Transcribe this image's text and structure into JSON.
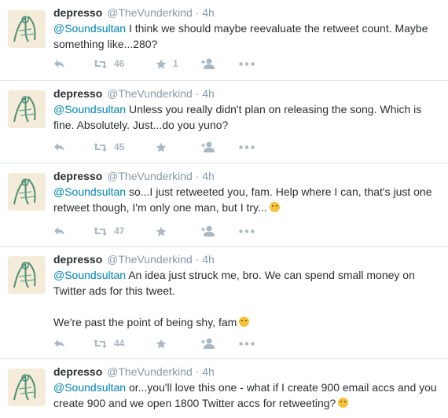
{
  "tweets": [
    {
      "name": "depresso",
      "handle": "@TheVunderkind",
      "dot": "·",
      "time": "4h",
      "mention": "@Soundsultan",
      "paragraphs": [
        "I think we should maybe reevaluate the retweet count. Maybe something like...280?"
      ],
      "retweets": "46",
      "favorites": "1",
      "emoji": ""
    },
    {
      "name": "depresso",
      "handle": "@TheVunderkind",
      "dot": "·",
      "time": "4h",
      "mention": "@Soundsultan",
      "paragraphs": [
        "Unless you really didn't plan on releasing the song. Which is fine. Absolutely. Just...do you yuno?"
      ],
      "retweets": "45",
      "favorites": "",
      "emoji": ""
    },
    {
      "name": "depresso",
      "handle": "@TheVunderkind",
      "dot": "·",
      "time": "4h",
      "mention": "@Soundsultan",
      "paragraphs": [
        "so...I just retweeted you, fam. Help where I can, that's just one retweet though, I'm only one man, but I try..."
      ],
      "retweets": "47",
      "favorites": "",
      "emoji": "relieved-face-emoji"
    },
    {
      "name": "depresso",
      "handle": "@TheVunderkind",
      "dot": "·",
      "time": "4h",
      "mention": "@Soundsultan",
      "paragraphs": [
        "An idea just struck me, bro. We can spend small money on Twitter ads for this tweet.",
        "We're past the point of being shy, fam"
      ],
      "retweets": "44",
      "favorites": "",
      "emoji": "disappointed-relieved-emoji"
    },
    {
      "name": "depresso",
      "handle": "@TheVunderkind",
      "dot": "·",
      "time": "4h",
      "mention": "@Soundsultan",
      "paragraphs": [
        "or...you'll love this one - what if I create 900 email accs and you create 900 and we open 1800 Twitter accs for retweeting?"
      ],
      "retweets": "",
      "favorites": "",
      "emoji": "relieved-face-emoji"
    }
  ],
  "colors": {
    "text": "#292f33",
    "muted": "#8899a6",
    "mention": "#0084b4",
    "action": "#aab8c2",
    "divider": "#e1e8ed"
  },
  "icons": [
    "reply-icon",
    "retweet-icon",
    "favorite-star-icon",
    "follow-icon",
    "more-icon"
  ]
}
